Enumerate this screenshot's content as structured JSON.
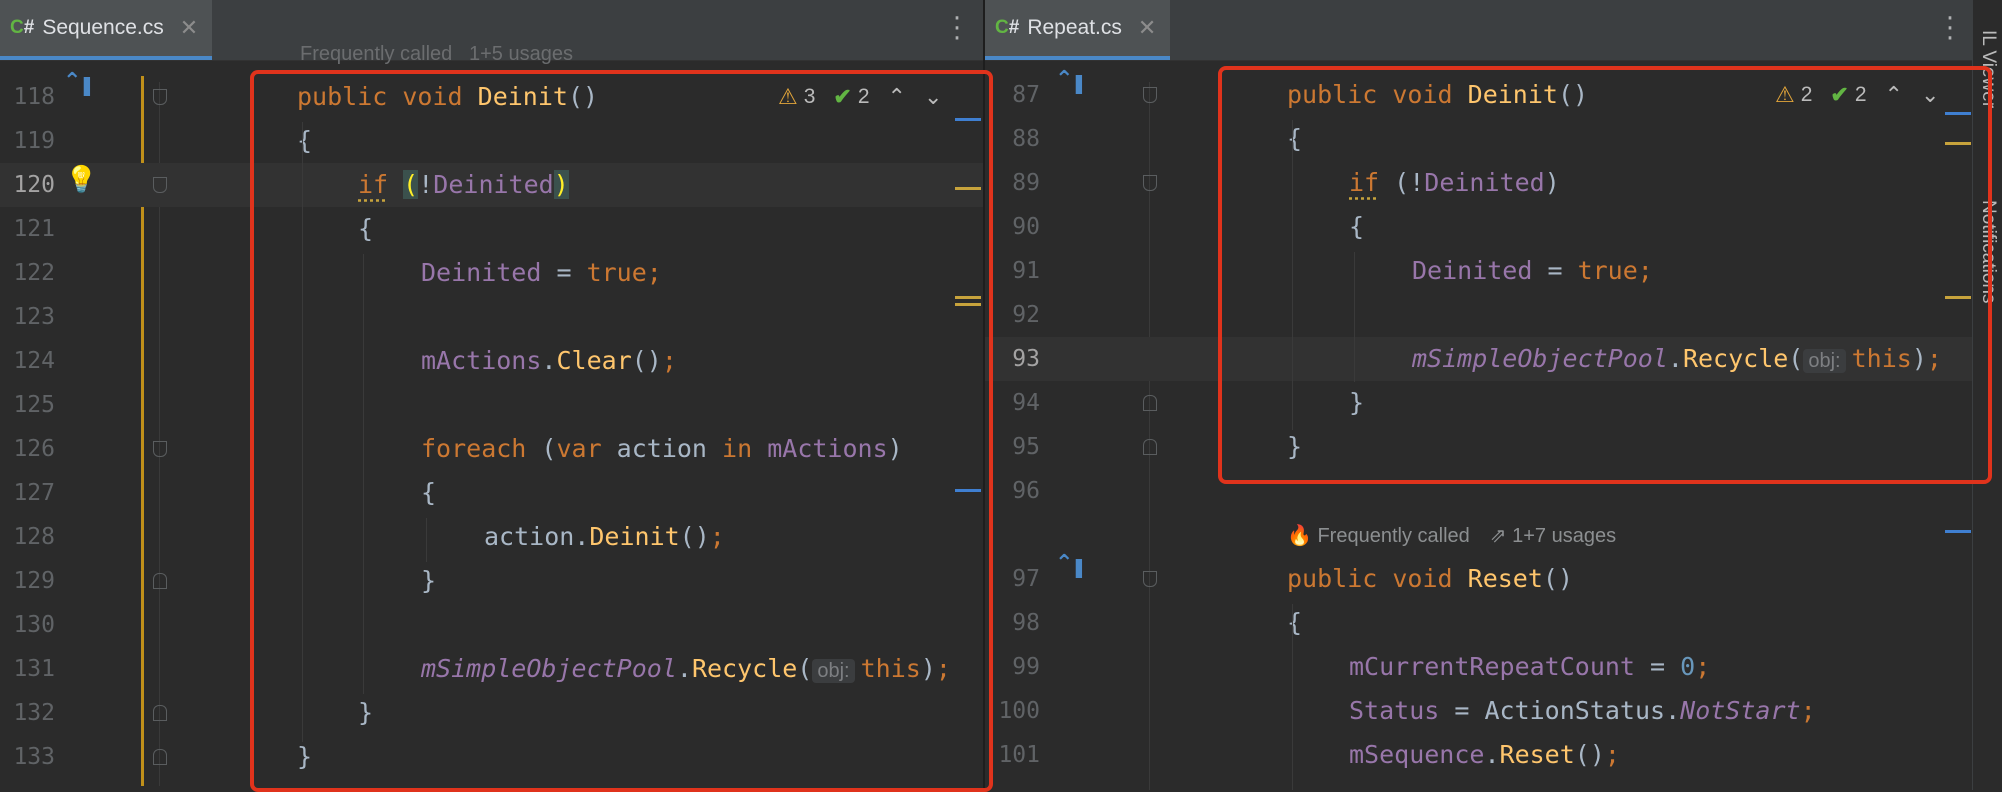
{
  "colors": {
    "accent": "#4a88c7",
    "highlight_box": "#e0331c",
    "warning": "#e2a53a",
    "ok": "#62b543"
  },
  "icons": {
    "menu": "kebab-menu-icon",
    "close": "close-icon",
    "warning": "warning-icon",
    "check": "check-icon",
    "bulb": "lightbulb-icon"
  },
  "left": {
    "tab": {
      "lang": "C#",
      "filename": "Sequence.cs"
    },
    "inspections": {
      "warnings": "3",
      "ok": "2"
    },
    "lens_top": "Frequently called   1+5 usages",
    "lines": [
      {
        "n": "118",
        "code": "public void Deinit()"
      },
      {
        "n": "119",
        "code": "{"
      },
      {
        "n": "120",
        "code": "if (!Deinited)"
      },
      {
        "n": "121",
        "code": "{"
      },
      {
        "n": "122",
        "code": "Deinited = true;"
      },
      {
        "n": "123",
        "code": ""
      },
      {
        "n": "124",
        "code": "mActions.Clear();"
      },
      {
        "n": "125",
        "code": ""
      },
      {
        "n": "126",
        "code": "foreach (var action in mActions)"
      },
      {
        "n": "127",
        "code": "{"
      },
      {
        "n": "128",
        "code": "action.Deinit();"
      },
      {
        "n": "129",
        "code": "}"
      },
      {
        "n": "130",
        "code": ""
      },
      {
        "n": "131",
        "code": "mSimpleObjectPool.Recycle(obj: this);"
      },
      {
        "n": "132",
        "code": "}"
      },
      {
        "n": "133",
        "code": "}"
      }
    ]
  },
  "right": {
    "tab": {
      "lang": "C#",
      "filename": "Repeat.cs"
    },
    "inspections": {
      "warnings": "2",
      "ok": "2"
    },
    "lens_mid": {
      "freq": "Frequently called",
      "usages": "1+7 usages"
    },
    "lines": [
      {
        "n": "87",
        "code": "public void Deinit()"
      },
      {
        "n": "88",
        "code": "{"
      },
      {
        "n": "89",
        "code": "if (!Deinited)"
      },
      {
        "n": "90",
        "code": "{"
      },
      {
        "n": "91",
        "code": "Deinited = true;"
      },
      {
        "n": "92",
        "code": ""
      },
      {
        "n": "93",
        "code": "mSimpleObjectPool.Recycle(obj: this);"
      },
      {
        "n": "94",
        "code": "}"
      },
      {
        "n": "95",
        "code": "}"
      },
      {
        "n": "96",
        "code": ""
      },
      {
        "n": "97",
        "code": "public void Reset()"
      },
      {
        "n": "98",
        "code": "{"
      },
      {
        "n": "99",
        "code": "mCurrentRepeatCount = 0;"
      },
      {
        "n": "100",
        "code": "Status = ActionStatus.NotStart;"
      },
      {
        "n": "101",
        "code": "mSequence.Reset();"
      }
    ]
  },
  "side_tools": [
    "IL Viewer",
    "Notifications"
  ]
}
